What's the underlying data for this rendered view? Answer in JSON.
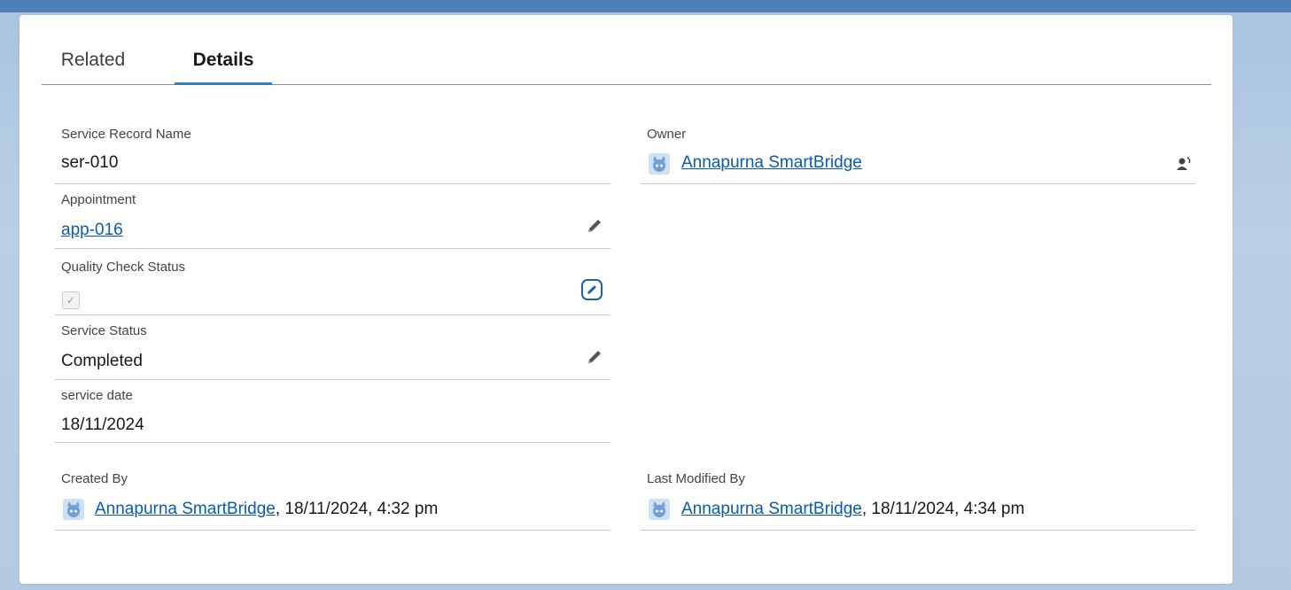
{
  "tabs": [
    {
      "label": "Related"
    },
    {
      "label": "Details",
      "active": true
    }
  ],
  "fields": {
    "service_record_name": {
      "label": "Service Record Name",
      "value": "ser-010"
    },
    "owner": {
      "label": "Owner",
      "value": "Annapurna SmartBridge"
    },
    "appointment": {
      "label": "Appointment",
      "value": "app-016"
    },
    "quality_check_status": {
      "label": "Quality Check Status",
      "checked": true
    },
    "service_status": {
      "label": "Service Status",
      "value": "Completed"
    },
    "service_date": {
      "label": "service date",
      "value": "18/11/2024"
    },
    "created_by": {
      "label": "Created By",
      "user": "Annapurna SmartBridge",
      "timestamp": ", 18/11/2024, 4:32 pm"
    },
    "last_modified_by": {
      "label": "Last Modified By",
      "user": "Annapurna SmartBridge",
      "timestamp": ", 18/11/2024, 4:34 pm"
    }
  },
  "icons": {
    "edit": "pencil-icon",
    "edit_focused": "pencil-icon",
    "change_owner": "change-owner-icon",
    "avatar": "user-avatar-icon",
    "checkmark": "checkmark-icon"
  },
  "colors": {
    "link": "#0b5cab",
    "tab_active_underline": "#2f7fd1",
    "focus_border": "#1f5fae",
    "background": "#b3c9e1"
  }
}
